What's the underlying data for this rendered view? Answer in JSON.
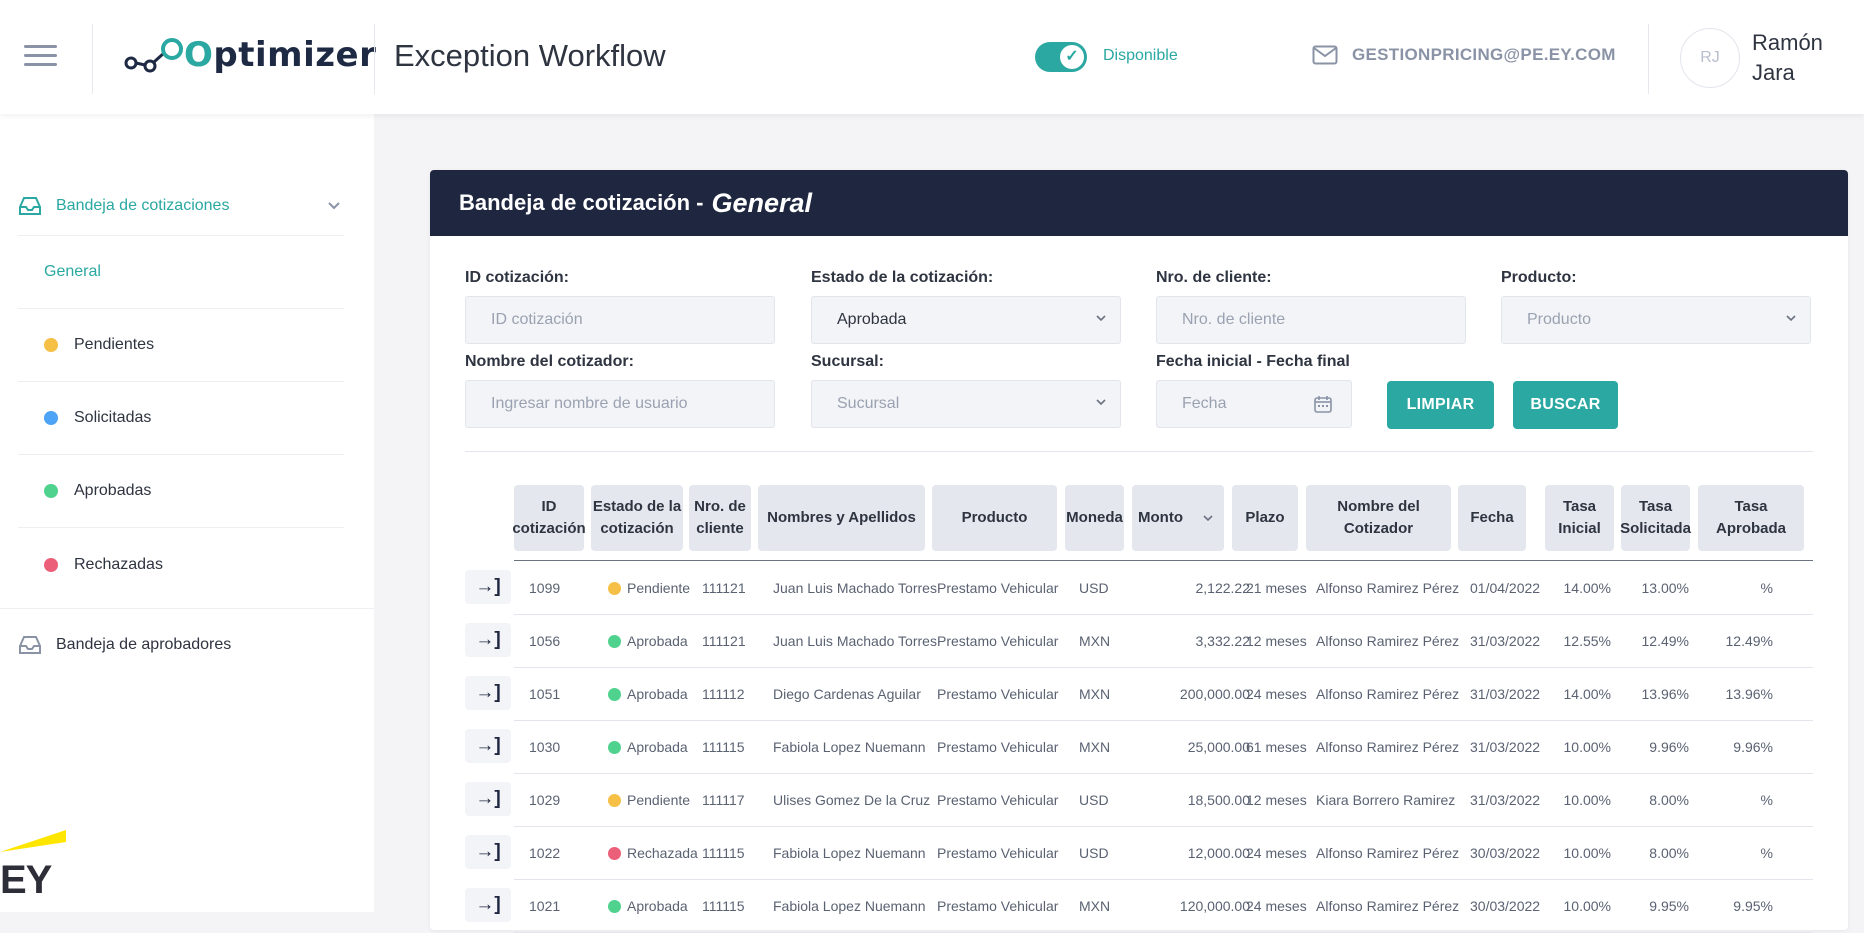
{
  "header": {
    "logo_text": "Optimizer",
    "app_title": "Exception Workflow",
    "status_label": "Disponible",
    "email": "GESTIONPRICING@PE.EY.COM",
    "avatar_initials": "RJ",
    "user_first": "Ramón",
    "user_last": "Jara"
  },
  "sidebar": {
    "section1": "Bandeja de cotizaciones",
    "items": [
      {
        "label": "General",
        "dot": ""
      },
      {
        "label": "Pendientes",
        "dot": "#f5c045"
      },
      {
        "label": "Solicitadas",
        "dot": "#4da3f5"
      },
      {
        "label": "Aprobadas",
        "dot": "#4fd28e"
      },
      {
        "label": "Rechazadas",
        "dot": "#ec5f79"
      }
    ],
    "section2": "Bandeja de aprobadores",
    "brand": "EY"
  },
  "card": {
    "title": "Bandeja de cotización -",
    "title_em": "General"
  },
  "filters": {
    "id_label": "ID cotización:",
    "id_placeholder": "ID cotización",
    "estado_label": "Estado de la cotización:",
    "estado_value": "Aprobada",
    "cliente_label": "Nro. de cliente:",
    "cliente_placeholder": "Nro. de cliente",
    "producto_label": "Producto:",
    "producto_placeholder": "Producto",
    "cotizador_label": "Nombre del cotizador:",
    "cotizador_placeholder": "Ingresar nombre de usuario",
    "sucursal_label": "Sucursal:",
    "sucursal_placeholder": "Sucursal",
    "fecha_label": "Fecha inicial - Fecha final",
    "fecha_placeholder": "Fecha",
    "limpiar": "LIMPIAR",
    "buscar": "BUSCAR"
  },
  "table": {
    "headers": {
      "id": [
        "ID",
        "cotización"
      ],
      "estado": [
        "Estado de la",
        "cotización"
      ],
      "cliente": [
        "Nro. de",
        "cliente"
      ],
      "nombres": "Nombres y Apellidos",
      "producto": "Producto",
      "moneda": "Moneda",
      "monto": "Monto",
      "plazo": "Plazo",
      "cotizador": [
        "Nombre del",
        "Cotizador"
      ],
      "fecha": "Fecha",
      "tasa_ini": [
        "Tasa",
        "Inicial"
      ],
      "tasa_sol": [
        "Tasa",
        "Solicitada"
      ],
      "tasa_apr": [
        "Tasa",
        "Aprobada"
      ]
    },
    "status_colors": {
      "Pendiente": "#f5c045",
      "Aprobada": "#4fd28e",
      "Rechazada": "#ec5f79"
    },
    "rows": [
      {
        "id": "1099",
        "estado": "Pendiente",
        "cliente": "111121",
        "nombre": "Juan Luis Machado Torres",
        "producto": "Prestamo Vehicular",
        "moneda": "USD",
        "monto": "2,122.22",
        "plazo": "21 meses",
        "cotizador": "Alfonso Ramirez Pérez",
        "fecha": "01/04/2022",
        "ini": "14.00%",
        "sol": "13.00%",
        "apr": "%"
      },
      {
        "id": "1056",
        "estado": "Aprobada",
        "cliente": "111121",
        "nombre": "Juan Luis Machado Torres",
        "producto": "Prestamo Vehicular",
        "moneda": "MXN",
        "monto": "3,332.22",
        "plazo": "12 meses",
        "cotizador": "Alfonso Ramirez Pérez",
        "fecha": "31/03/2022",
        "ini": "12.55%",
        "sol": "12.49%",
        "apr": "12.49%"
      },
      {
        "id": "1051",
        "estado": "Aprobada",
        "cliente": "111112",
        "nombre": "Diego Cardenas Aguilar",
        "producto": "Prestamo Vehicular",
        "moneda": "MXN",
        "monto": "200,000.00",
        "plazo": "24 meses",
        "cotizador": "Alfonso Ramirez Pérez",
        "fecha": "31/03/2022",
        "ini": "14.00%",
        "sol": "13.96%",
        "apr": "13.96%"
      },
      {
        "id": "1030",
        "estado": "Aprobada",
        "cliente": "111115",
        "nombre": "Fabiola Lopez Nuemann",
        "producto": "Prestamo Vehicular",
        "moneda": "MXN",
        "monto": "25,000.00",
        "plazo": "61 meses",
        "cotizador": "Alfonso Ramirez Pérez",
        "fecha": "31/03/2022",
        "ini": "10.00%",
        "sol": "9.96%",
        "apr": "9.96%"
      },
      {
        "id": "1029",
        "estado": "Pendiente",
        "cliente": "111117",
        "nombre": "Ulises Gomez De la Cruz",
        "producto": "Prestamo Vehicular",
        "moneda": "USD",
        "monto": "18,500.00",
        "plazo": "12 meses",
        "cotizador": "Kiara Borrero Ramirez",
        "fecha": "31/03/2022",
        "ini": "10.00%",
        "sol": "8.00%",
        "apr": "%"
      },
      {
        "id": "1022",
        "estado": "Rechazada",
        "cliente": "111115",
        "nombre": "Fabiola Lopez Nuemann",
        "producto": "Prestamo Vehicular",
        "moneda": "USD",
        "monto": "12,000.00",
        "plazo": "24 meses",
        "cotizador": "Alfonso Ramirez Pérez",
        "fecha": "30/03/2022",
        "ini": "10.00%",
        "sol": "8.00%",
        "apr": "%"
      },
      {
        "id": "1021",
        "estado": "Aprobada",
        "cliente": "111115",
        "nombre": "Fabiola Lopez Nuemann",
        "producto": "Prestamo Vehicular",
        "moneda": "MXN",
        "monto": "120,000.00",
        "plazo": "24 meses",
        "cotizador": "Alfonso Ramirez Pérez",
        "fecha": "30/03/2022",
        "ini": "10.00%",
        "sol": "9.95%",
        "apr": "9.95%"
      }
    ]
  }
}
